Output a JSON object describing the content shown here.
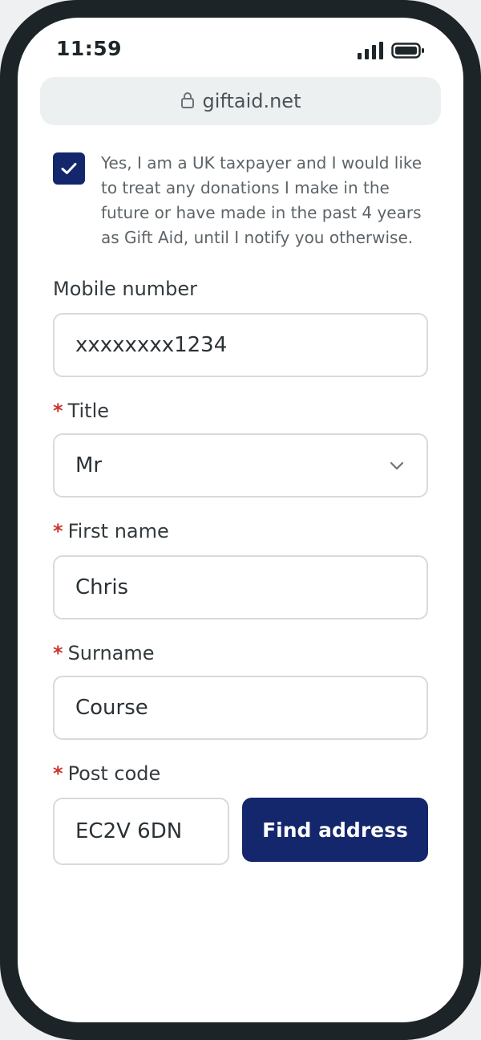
{
  "status_bar": {
    "time": "11:59",
    "signal_icon": "cellular-signal-icon",
    "battery_icon": "battery-icon"
  },
  "browser": {
    "url": "giftaid.net",
    "lock_icon": "lock-icon"
  },
  "consent": {
    "checked": true,
    "text": "Yes, I am a UK taxpayer and I would like to treat any donations I make in the future or have made in the past 4 years as Gift Aid, until I notify you otherwise."
  },
  "form": {
    "required_marker": "*",
    "mobile": {
      "label": "Mobile number",
      "value": "xxxxxxxx1234"
    },
    "title": {
      "label": "Title",
      "value": "Mr"
    },
    "first_name": {
      "label": "First name",
      "value": "Chris"
    },
    "surname": {
      "label": "Surname",
      "value": "Course"
    },
    "postcode": {
      "label": "Post code",
      "value": "EC2V 6DN"
    },
    "find_address_label": "Find address"
  },
  "colors": {
    "primary": "#14266c",
    "required": "#c8372c",
    "frame": "#1d2427"
  }
}
